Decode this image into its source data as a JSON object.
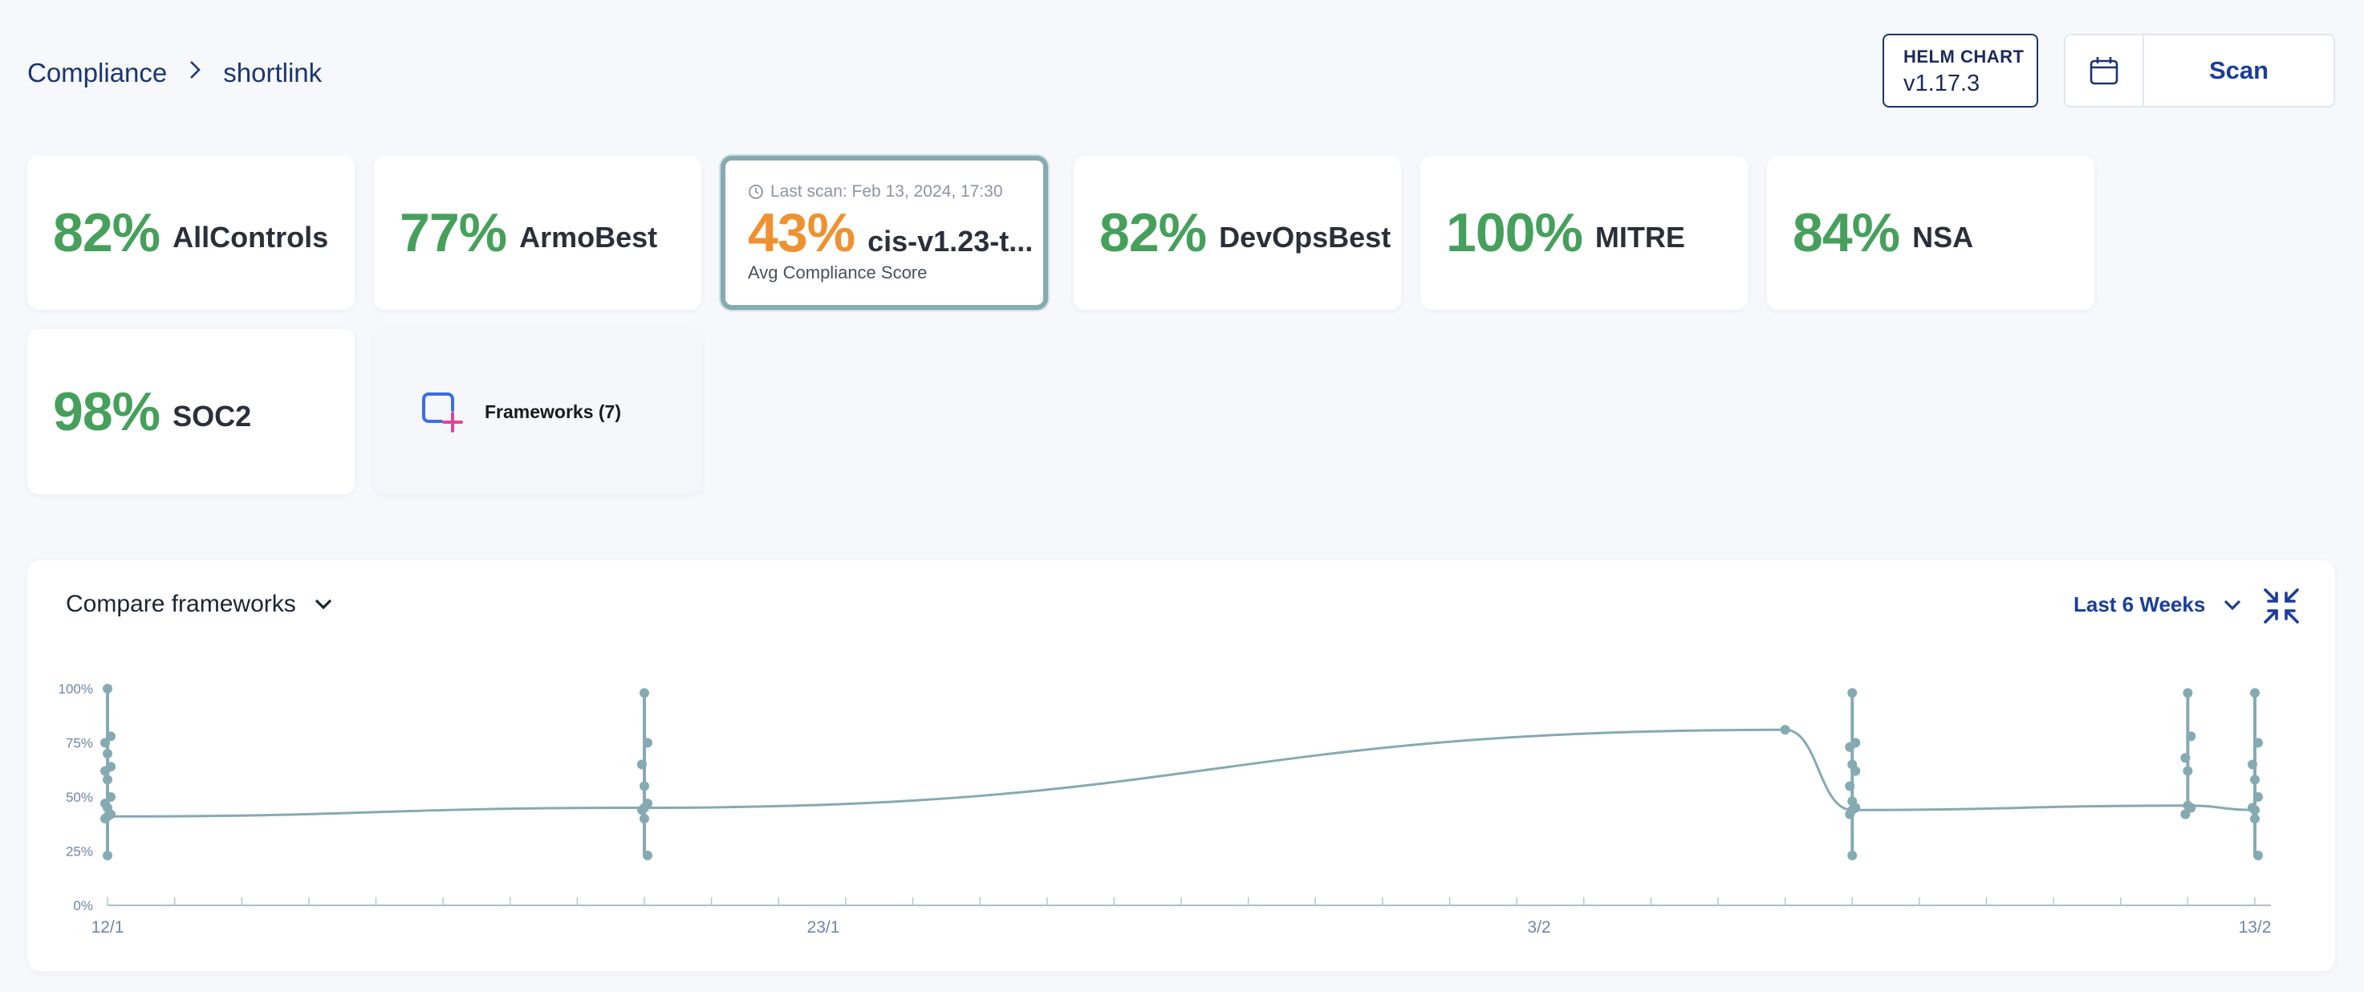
{
  "breadcrumb": {
    "root": "Compliance",
    "current": "shortlink"
  },
  "helm": {
    "title": "HELM CHART",
    "version": "v1.17.3"
  },
  "scan": {
    "calendar_icon": "calendar-icon",
    "label": "Scan"
  },
  "frameworks": [
    {
      "pct": "82%",
      "name": "AllControls"
    },
    {
      "pct": "77%",
      "name": "ArmoBest"
    },
    {
      "pct": "43%",
      "name": "cis-v1.23-t...",
      "last_scan": "Last scan: Feb 13, 2024, 17:30",
      "sub": "Avg Compliance Score",
      "selected": true
    },
    {
      "pct": "82%",
      "name": "DevOpsBest"
    },
    {
      "pct": "100%",
      "name": "MITRE"
    },
    {
      "pct": "84%",
      "name": "NSA"
    },
    {
      "pct": "98%",
      "name": "SOC2"
    }
  ],
  "add_frameworks": {
    "label": "Frameworks (7)",
    "icon": "add-framework-icon"
  },
  "panel": {
    "compare_label": "Compare frameworks",
    "range_label": "Last 6 Weeks",
    "collapse_icon": "collapse-icon"
  },
  "colors": {
    "good": "#46a05c",
    "warn": "#ef9130",
    "accent": "#1a3d9a",
    "line": "#85aab2"
  },
  "chart_data": {
    "type": "line",
    "x_tick_labels": [
      "12/1",
      "23/1",
      "3/2",
      "13/2"
    ],
    "y_tick_labels": [
      "0%",
      "25%",
      "50%",
      "75%",
      "100%"
    ],
    "ylim": [
      0,
      100
    ],
    "xlim": [
      "2024-01-12",
      "2024-02-13"
    ],
    "series": [
      {
        "points": [
          {
            "x": "2024-01-12",
            "y": 41
          },
          {
            "x": "2024-01-20",
            "y": 45
          },
          {
            "x": "2024-02-06",
            "y": 81
          },
          {
            "x": "2024-02-07",
            "y": 44
          },
          {
            "x": "2024-02-12",
            "y": 46
          },
          {
            "x": "2024-02-13",
            "y": 44
          }
        ]
      }
    ],
    "scan_clusters": [
      {
        "x": "2024-01-12",
        "values": [
          100,
          78,
          75,
          70,
          64,
          62,
          58,
          50,
          47,
          45,
          42,
          40,
          23
        ]
      },
      {
        "x": "2024-01-20",
        "values": [
          98,
          75,
          65,
          55,
          47,
          44,
          40,
          23
        ]
      },
      {
        "x": "2024-02-07",
        "values": [
          98,
          75,
          73,
          65,
          62,
          55,
          48,
          45,
          42,
          23
        ]
      },
      {
        "x": "2024-02-12",
        "values": [
          98,
          78,
          68,
          62,
          45,
          42
        ]
      },
      {
        "x": "2024-02-13",
        "values": [
          98,
          75,
          65,
          58,
          50,
          45,
          40,
          23
        ]
      }
    ]
  }
}
